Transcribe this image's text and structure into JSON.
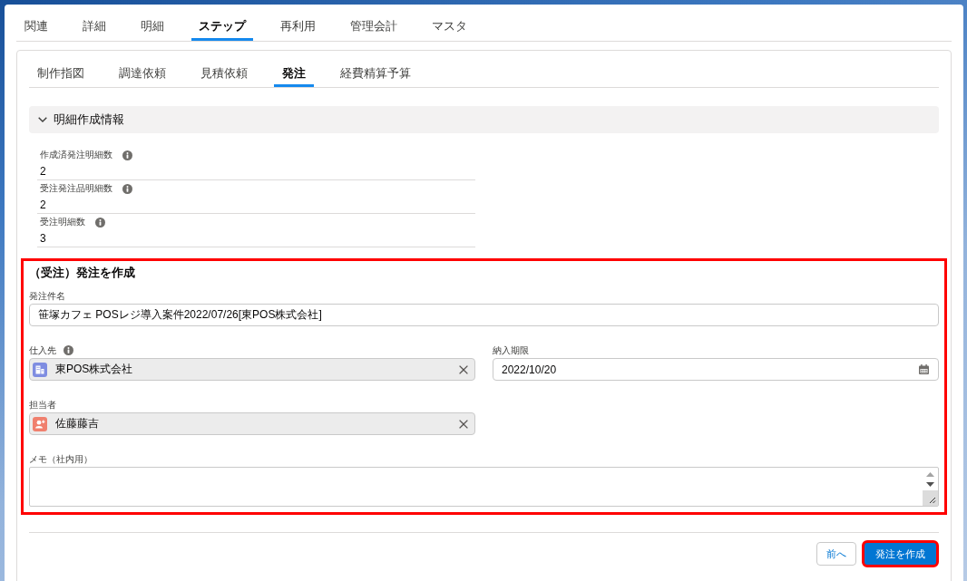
{
  "record_tabs": [
    {
      "label": "関連",
      "selected": false
    },
    {
      "label": "詳細",
      "selected": false
    },
    {
      "label": "明細",
      "selected": false
    },
    {
      "label": "ステップ",
      "selected": true
    },
    {
      "label": "再利用",
      "selected": false
    },
    {
      "label": "管理会計",
      "selected": false
    },
    {
      "label": "マスタ",
      "selected": false
    }
  ],
  "step_tabs": [
    {
      "label": "制作指図",
      "selected": false
    },
    {
      "label": "調達依頼",
      "selected": false
    },
    {
      "label": "見積依頼",
      "selected": false
    },
    {
      "label": "発注",
      "selected": true
    },
    {
      "label": "経費精算予算",
      "selected": false
    }
  ],
  "section": {
    "title": "明細作成情報",
    "expanded": true,
    "fields": [
      {
        "label": "作成済発注明細数",
        "info": true,
        "value": "2"
      },
      {
        "label": "受注発注品明細数",
        "info": true,
        "value": "2"
      },
      {
        "label": "受注明細数",
        "info": true,
        "value": "3"
      }
    ]
  },
  "form": {
    "title": "（受注）発注を作成",
    "highlighted": true,
    "fields": [
      {
        "kind": "text",
        "label": "発注件名",
        "info": false,
        "value": "笹塚カフェ POSレジ導入案件2022/07/26[東POS株式会社]"
      },
      {
        "kind": "account",
        "label": "仕入先",
        "info": true,
        "value": "東POS株式会社"
      },
      {
        "kind": "date",
        "label": "納入期限",
        "info": false,
        "value": "2022/10/20"
      },
      {
        "kind": "user",
        "label": "担当者",
        "info": false,
        "value": "佐藤藤吉"
      },
      {
        "kind": "textarea",
        "label": "メモ（社内用）",
        "info": false
      }
    ]
  },
  "buttons": [
    {
      "label": "前へ",
      "kind": "neutral",
      "highlighted": false
    },
    {
      "label": "発注を作成",
      "kind": "brand",
      "highlighted": true
    }
  ]
}
